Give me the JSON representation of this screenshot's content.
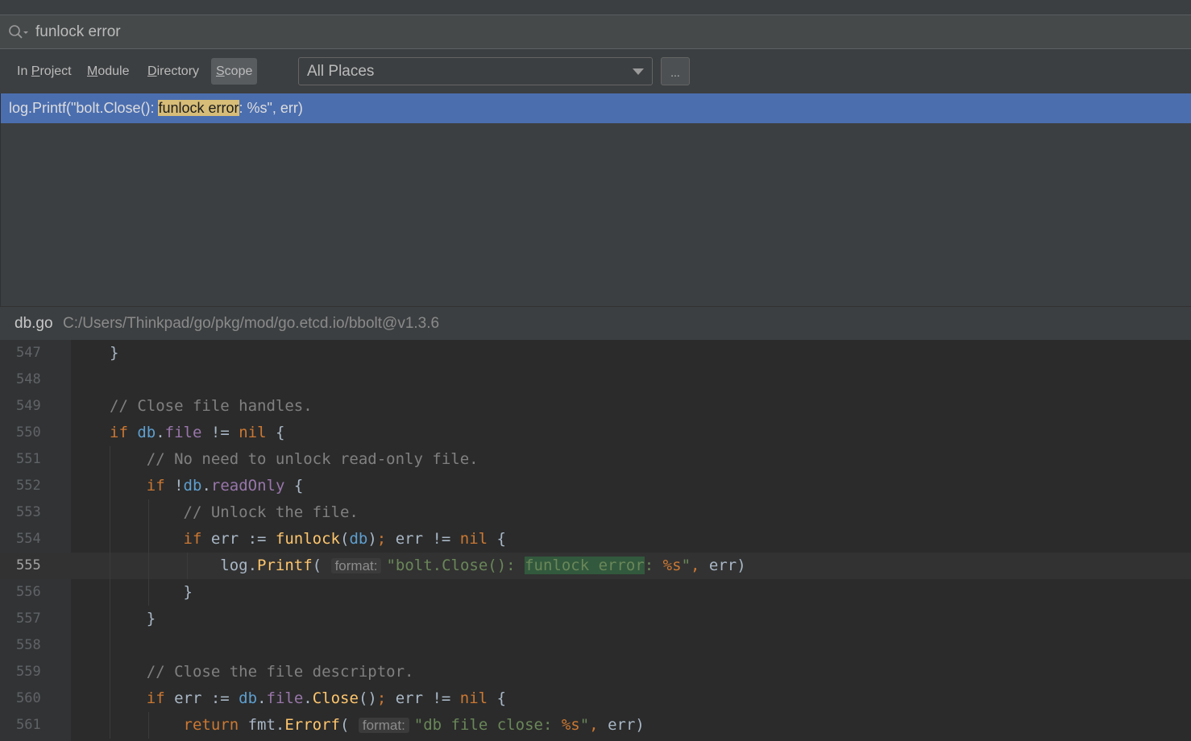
{
  "search": {
    "query": "funlock error",
    "icon": "search-icon"
  },
  "scope": {
    "tabs": [
      {
        "prefix": "In ",
        "mnemonic": "P",
        "rest": "roject"
      },
      {
        "prefix": "",
        "mnemonic": "M",
        "rest": "odule"
      },
      {
        "prefix": "",
        "mnemonic": "D",
        "rest": "irectory"
      },
      {
        "prefix": "",
        "mnemonic": "S",
        "rest": "cope"
      }
    ],
    "active_tab": "Scope",
    "dropdown_value": "All Places",
    "more_label": "..."
  },
  "results": [
    {
      "before": "log.Printf(\"bolt.Close(): ",
      "match": "funlock error",
      "after": ": %s\", err)"
    }
  ],
  "preview": {
    "file_name": "db.go",
    "file_path": "C:/Users/Thinkpad/go/pkg/mod/go.etcd.io/bbolt@v1.3.6",
    "current_line": 555,
    "lines": [
      {
        "num": "547",
        "t": [
          [
            "",
            "}"
          ]
        ]
      },
      {
        "num": "548",
        "t": []
      },
      {
        "num": "549",
        "t": [
          [
            "cm",
            "// Close file handles."
          ]
        ]
      },
      {
        "num": "550",
        "t": [
          [
            "kw",
            "if "
          ],
          [
            "db",
            "db"
          ],
          [
            "",
            "."
          ],
          [
            "fld",
            "file"
          ],
          [
            "",
            " != "
          ],
          [
            "kw",
            "nil"
          ],
          [
            "",
            " {"
          ]
        ]
      },
      {
        "num": "551",
        "t": [
          [
            "",
            "    "
          ],
          [
            "cm",
            "// No need to unlock read-only file."
          ]
        ]
      },
      {
        "num": "552",
        "t": [
          [
            "",
            "    "
          ],
          [
            "kw",
            "if "
          ],
          [
            "",
            "!"
          ],
          [
            "db",
            "db"
          ],
          [
            "",
            "."
          ],
          [
            "fld",
            "readOnly"
          ],
          [
            "",
            " {"
          ]
        ]
      },
      {
        "num": "553",
        "t": [
          [
            "",
            "        "
          ],
          [
            "cm",
            "// Unlock the file."
          ]
        ]
      },
      {
        "num": "554",
        "t": [
          [
            "",
            "        "
          ],
          [
            "kw",
            "if "
          ],
          [
            "",
            "err := "
          ],
          [
            "fn",
            "funlock"
          ],
          [
            "",
            "("
          ],
          [
            "db",
            "db"
          ],
          [
            "",
            ")"
          ],
          [
            "kw",
            ";"
          ],
          [
            "",
            " err != "
          ],
          [
            "kw",
            "nil"
          ],
          [
            "",
            " {"
          ]
        ]
      },
      {
        "num": "555",
        "t": [
          [
            "",
            "            log."
          ],
          [
            "fn",
            "Printf"
          ],
          [
            "",
            "( "
          ],
          [
            "hint",
            "format:"
          ],
          [
            "str",
            "\"bolt.Close(): "
          ],
          [
            "match",
            "funlock error"
          ],
          [
            "str",
            ": "
          ],
          [
            "fmt",
            "%s"
          ],
          [
            "str",
            "\""
          ],
          [
            "kw",
            ","
          ],
          [
            "",
            " err)"
          ]
        ]
      },
      {
        "num": "556",
        "t": [
          [
            "",
            "        }"
          ]
        ]
      },
      {
        "num": "557",
        "t": [
          [
            "",
            "    }"
          ]
        ]
      },
      {
        "num": "558",
        "t": []
      },
      {
        "num": "559",
        "t": [
          [
            "",
            "    "
          ],
          [
            "cm",
            "// Close the file descriptor."
          ]
        ]
      },
      {
        "num": "560",
        "t": [
          [
            "",
            "    "
          ],
          [
            "kw",
            "if "
          ],
          [
            "",
            "err := "
          ],
          [
            "db",
            "db"
          ],
          [
            "",
            "."
          ],
          [
            "fld",
            "file"
          ],
          [
            "",
            "."
          ],
          [
            "fn",
            "Close"
          ],
          [
            "",
            "()"
          ],
          [
            "kw",
            ";"
          ],
          [
            "",
            " err != "
          ],
          [
            "kw",
            "nil"
          ],
          [
            "",
            " {"
          ]
        ]
      },
      {
        "num": "561",
        "t": [
          [
            "",
            "        "
          ],
          [
            "kw",
            "return "
          ],
          [
            "",
            "fmt."
          ],
          [
            "fn",
            "Errorf"
          ],
          [
            "",
            "( "
          ],
          [
            "hint",
            "format:"
          ],
          [
            "str",
            "\"db file close: "
          ],
          [
            "fmt",
            "%s"
          ],
          [
            "str",
            "\""
          ],
          [
            "kw",
            ","
          ],
          [
            "",
            " err)"
          ]
        ]
      }
    ]
  }
}
